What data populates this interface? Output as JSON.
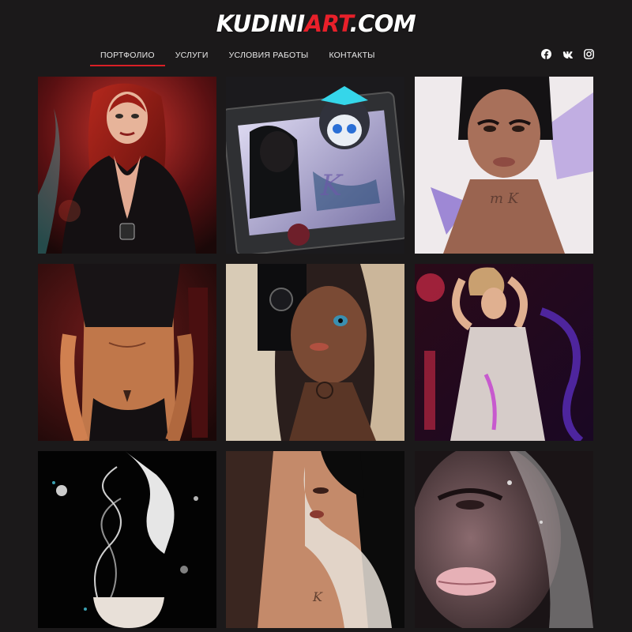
{
  "header": {
    "logo_part1": "KUDINI",
    "logo_part2": "ART",
    "logo_part3": ".COM"
  },
  "nav": {
    "items": [
      {
        "label": "ПОРТФОЛИО"
      },
      {
        "label": "УСЛУГИ"
      },
      {
        "label": "УСЛОВИЯ РАБОТЫ"
      },
      {
        "label": "КОНТАКТЫ"
      }
    ],
    "active_index": 0
  },
  "social": [
    "facebook-icon",
    "vk-icon",
    "instagram-icon"
  ],
  "colors": {
    "background": "#1b191a",
    "accent": "#d91f26",
    "logo_red": "#e8202a"
  },
  "gallery": {
    "items": [
      {
        "palette": [
          "#6b0f12",
          "#b22a25",
          "#1a1416",
          "#e06a4e"
        ]
      },
      {
        "palette": [
          "#3d3d45",
          "#8a86b8",
          "#1f2a3a",
          "#3ad0ea"
        ]
      },
      {
        "palette": [
          "#f2efee",
          "#c9b6e6",
          "#9a6a50",
          "#1a1a1a"
        ]
      },
      {
        "palette": [
          "#2a0c0e",
          "#7a1b1c",
          "#c57a4e",
          "#0c0c0c"
        ]
      },
      {
        "palette": [
          "#0f0f11",
          "#d8c9b0",
          "#7a4a35",
          "#3a8fb0"
        ]
      },
      {
        "palette": [
          "#120712",
          "#d22b48",
          "#e6ddd8",
          "#5a2dbd"
        ]
      },
      {
        "palette": [
          "#030303",
          "#ffffff",
          "#3aa0b0",
          "#cfcfcf"
        ]
      },
      {
        "palette": [
          "#0b0b0b",
          "#c48a6a",
          "#e8e0d8",
          "#7a4a3a"
        ]
      },
      {
        "palette": [
          "#1a1416",
          "#7e5a5e",
          "#e6b0b6",
          "#ffffff"
        ]
      }
    ]
  }
}
